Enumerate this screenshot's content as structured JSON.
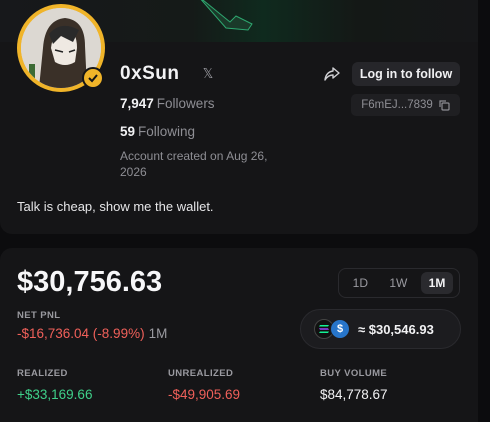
{
  "profile": {
    "username": "0xSun",
    "followers_count": "7,947",
    "followers_label": "Followers",
    "following_count": "59",
    "following_label": "Following",
    "created": "Account created on Aug 26, 2026",
    "bio": "Talk is cheap, show me the wallet.",
    "social_icon": "x-logo-icon",
    "login_label": "Log in to follow",
    "wallet_short": "F6mEJ...7839",
    "accent_color": "#f0b429"
  },
  "pnl": {
    "value": "$30,756.63",
    "label": "NET PNL",
    "change": "-$16,736.04 (-8.99%)",
    "period": "1M",
    "tabs": [
      "1D",
      "1W",
      "1M"
    ],
    "active_tab": "1M",
    "balance": "≈ $30,546.93",
    "metrics": {
      "realized_label": "REALIZED",
      "realized_value": "+$33,169.66",
      "unrealized_label": "UNREALIZED",
      "unrealized_value": "-$49,905.69",
      "volume_label": "BUY VOLUME",
      "volume_value": "$84,778.67"
    },
    "colors": {
      "positive": "#3fd08a",
      "negative": "#f0605a"
    }
  }
}
